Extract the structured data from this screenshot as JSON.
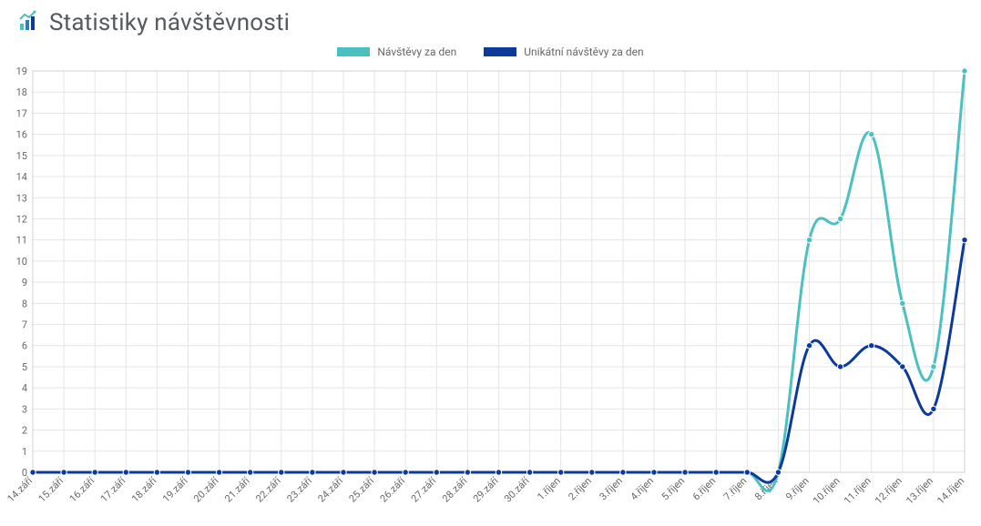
{
  "title": "Statistiky návštěvnosti",
  "legend": {
    "series1": "Návštěvy za den",
    "series2": "Unikátní návštěvy za den"
  },
  "colors": {
    "series1": "#4bc0c0",
    "series2": "#0b3a9b",
    "grid": "#e5e5e5",
    "text": "#666666"
  },
  "chart_data": {
    "type": "line",
    "xlabel": "",
    "ylabel": "",
    "ylim": [
      0,
      19
    ],
    "yticks": [
      0,
      1,
      2,
      3,
      4,
      5,
      6,
      7,
      8,
      9,
      10,
      11,
      12,
      13,
      14,
      15,
      16,
      17,
      18,
      19
    ],
    "categories": [
      "14.září",
      "15.září",
      "16.září",
      "17.září",
      "18.září",
      "19.září",
      "20.září",
      "21.září",
      "22.září",
      "23.září",
      "24.září",
      "25.září",
      "26.září",
      "27.září",
      "28.září",
      "29.září",
      "30.září",
      "1.říjen",
      "2.říjen",
      "3.říjen",
      "4.říjen",
      "5.říjen",
      "6.říjen",
      "7.říjen",
      "8.říjen",
      "9.říjen",
      "10.říjen",
      "11.říjen",
      "12.říjen",
      "13.říjen",
      "14.říjen"
    ],
    "series": [
      {
        "name": "Návštěvy za den",
        "color": "#4bc0c0",
        "values": [
          0,
          0,
          0,
          0,
          0,
          0,
          0,
          0,
          0,
          0,
          0,
          0,
          0,
          0,
          0,
          0,
          0,
          0,
          0,
          0,
          0,
          0,
          0,
          0,
          0,
          11,
          12,
          16,
          8,
          5,
          19
        ]
      },
      {
        "name": "Unikátní návštěvy za den",
        "color": "#0b3a9b",
        "values": [
          0,
          0,
          0,
          0,
          0,
          0,
          0,
          0,
          0,
          0,
          0,
          0,
          0,
          0,
          0,
          0,
          0,
          0,
          0,
          0,
          0,
          0,
          0,
          0,
          0,
          6,
          5,
          6,
          5,
          3,
          11
        ]
      }
    ]
  }
}
